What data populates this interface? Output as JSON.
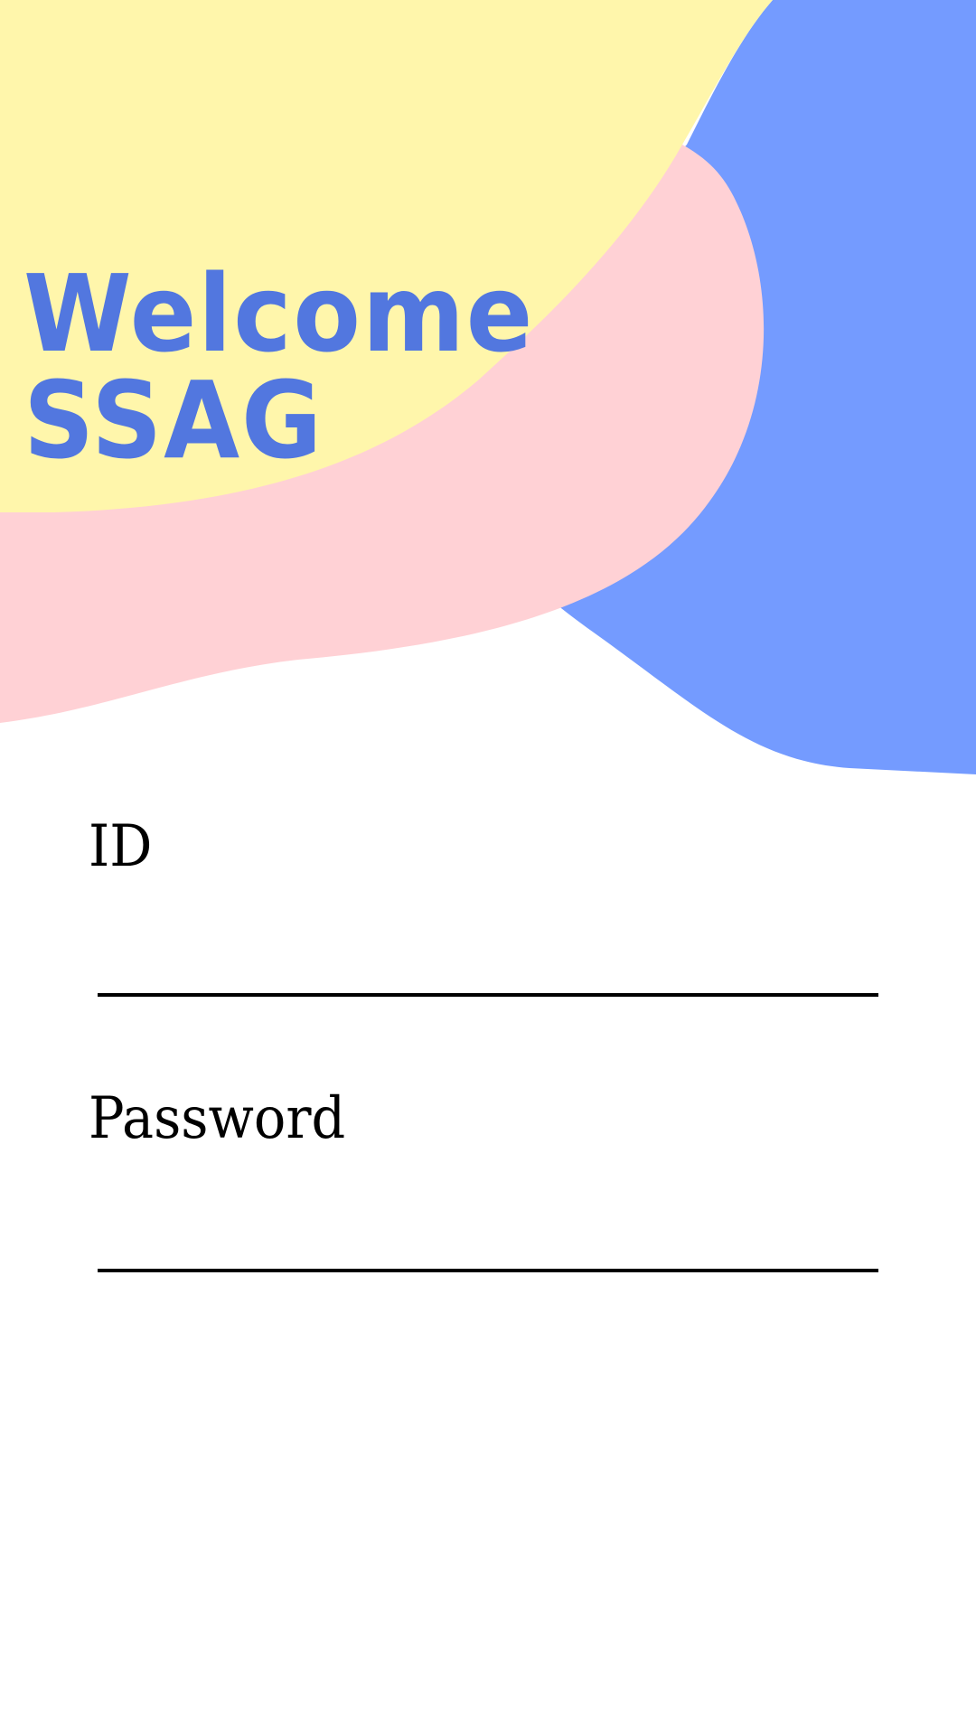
{
  "header": {
    "line1": "Welcome",
    "line2": "SSAG"
  },
  "form": {
    "id_label": "ID",
    "id_value": "",
    "password_label": "Password",
    "password_value": ""
  },
  "colors": {
    "yellow_blob": "#fff6ab",
    "pink_blob": "#ffd1d5",
    "blue_blob": "#749bff",
    "title": "#5277df"
  }
}
